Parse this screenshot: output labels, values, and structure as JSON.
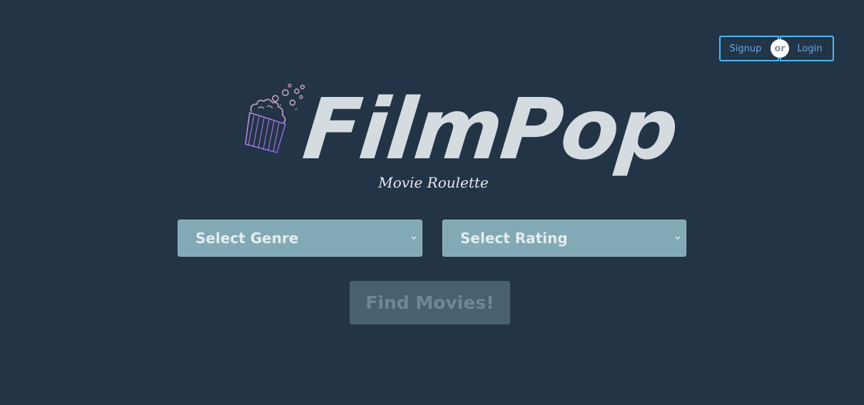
{
  "auth": {
    "signup_label": "Signup",
    "or_label": "or",
    "login_label": "Login"
  },
  "brand": {
    "logo_text": "FilmPop",
    "tagline": "Movie Roulette",
    "icon": "popcorn-icon"
  },
  "filters": {
    "genre_label": "Select Genre",
    "rating_label": "Select Rating"
  },
  "actions": {
    "find_label": "Find Movies!"
  },
  "colors": {
    "background": "#233447",
    "accent": "#4fb7ef",
    "select_bg": "#82a9b6",
    "button_bg": "#47616f",
    "logo_text": "#d4dce0"
  }
}
